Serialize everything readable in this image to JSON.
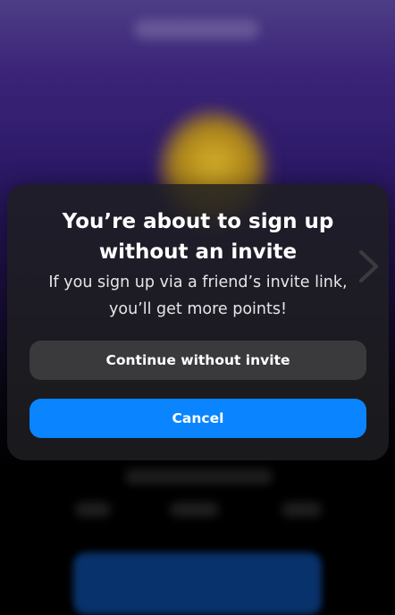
{
  "dialog": {
    "title": "You’re about to sign up without an invite",
    "message": "If you sign up via a friend’s invite link, you’ll get more points!",
    "continue_label": "Continue without invite",
    "cancel_label": "Cancel"
  },
  "navigation": {
    "next_icon": "chevron-right-icon"
  },
  "colors": {
    "accent": "#0a84ff",
    "dialog_background": "#1e1e22",
    "secondary_button": "#3a3a3d",
    "text": "#ffffff"
  }
}
